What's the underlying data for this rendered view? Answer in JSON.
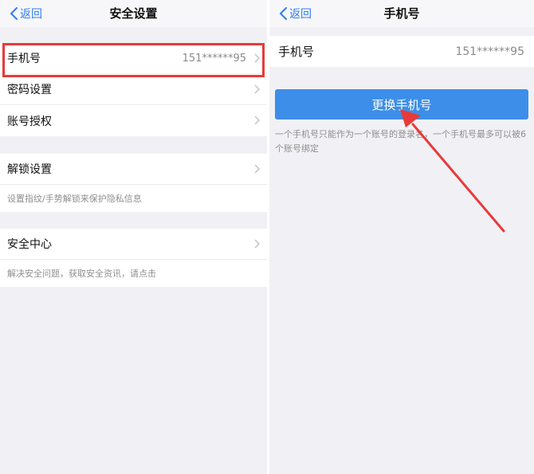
{
  "left": {
    "back_label": "返回",
    "title": "安全设置",
    "group1": [
      {
        "label": "手机号",
        "value": "151******95"
      },
      {
        "label": "密码设置"
      },
      {
        "label": "账号授权"
      }
    ],
    "group2": {
      "label": "解锁设置",
      "desc": "设置指纹/手势解锁来保护隐私信息"
    },
    "group3": {
      "label": "安全中心",
      "desc": "解决安全问题，获取安全资讯，请点击"
    }
  },
  "right": {
    "back_label": "返回",
    "title": "手机号",
    "phone_label": "手机号",
    "phone_value": "151******95",
    "change_button": "更换手机号",
    "note": "一个手机号只能作为一个账号的登录名，一个手机号最多可以被6个账号绑定"
  },
  "colors": {
    "accent": "#2f7cf6",
    "button": "#3d8ee8",
    "highlight": "#e83a3a"
  },
  "icons": {
    "back": "chevron-left-icon",
    "row": "chevron-right-icon"
  }
}
